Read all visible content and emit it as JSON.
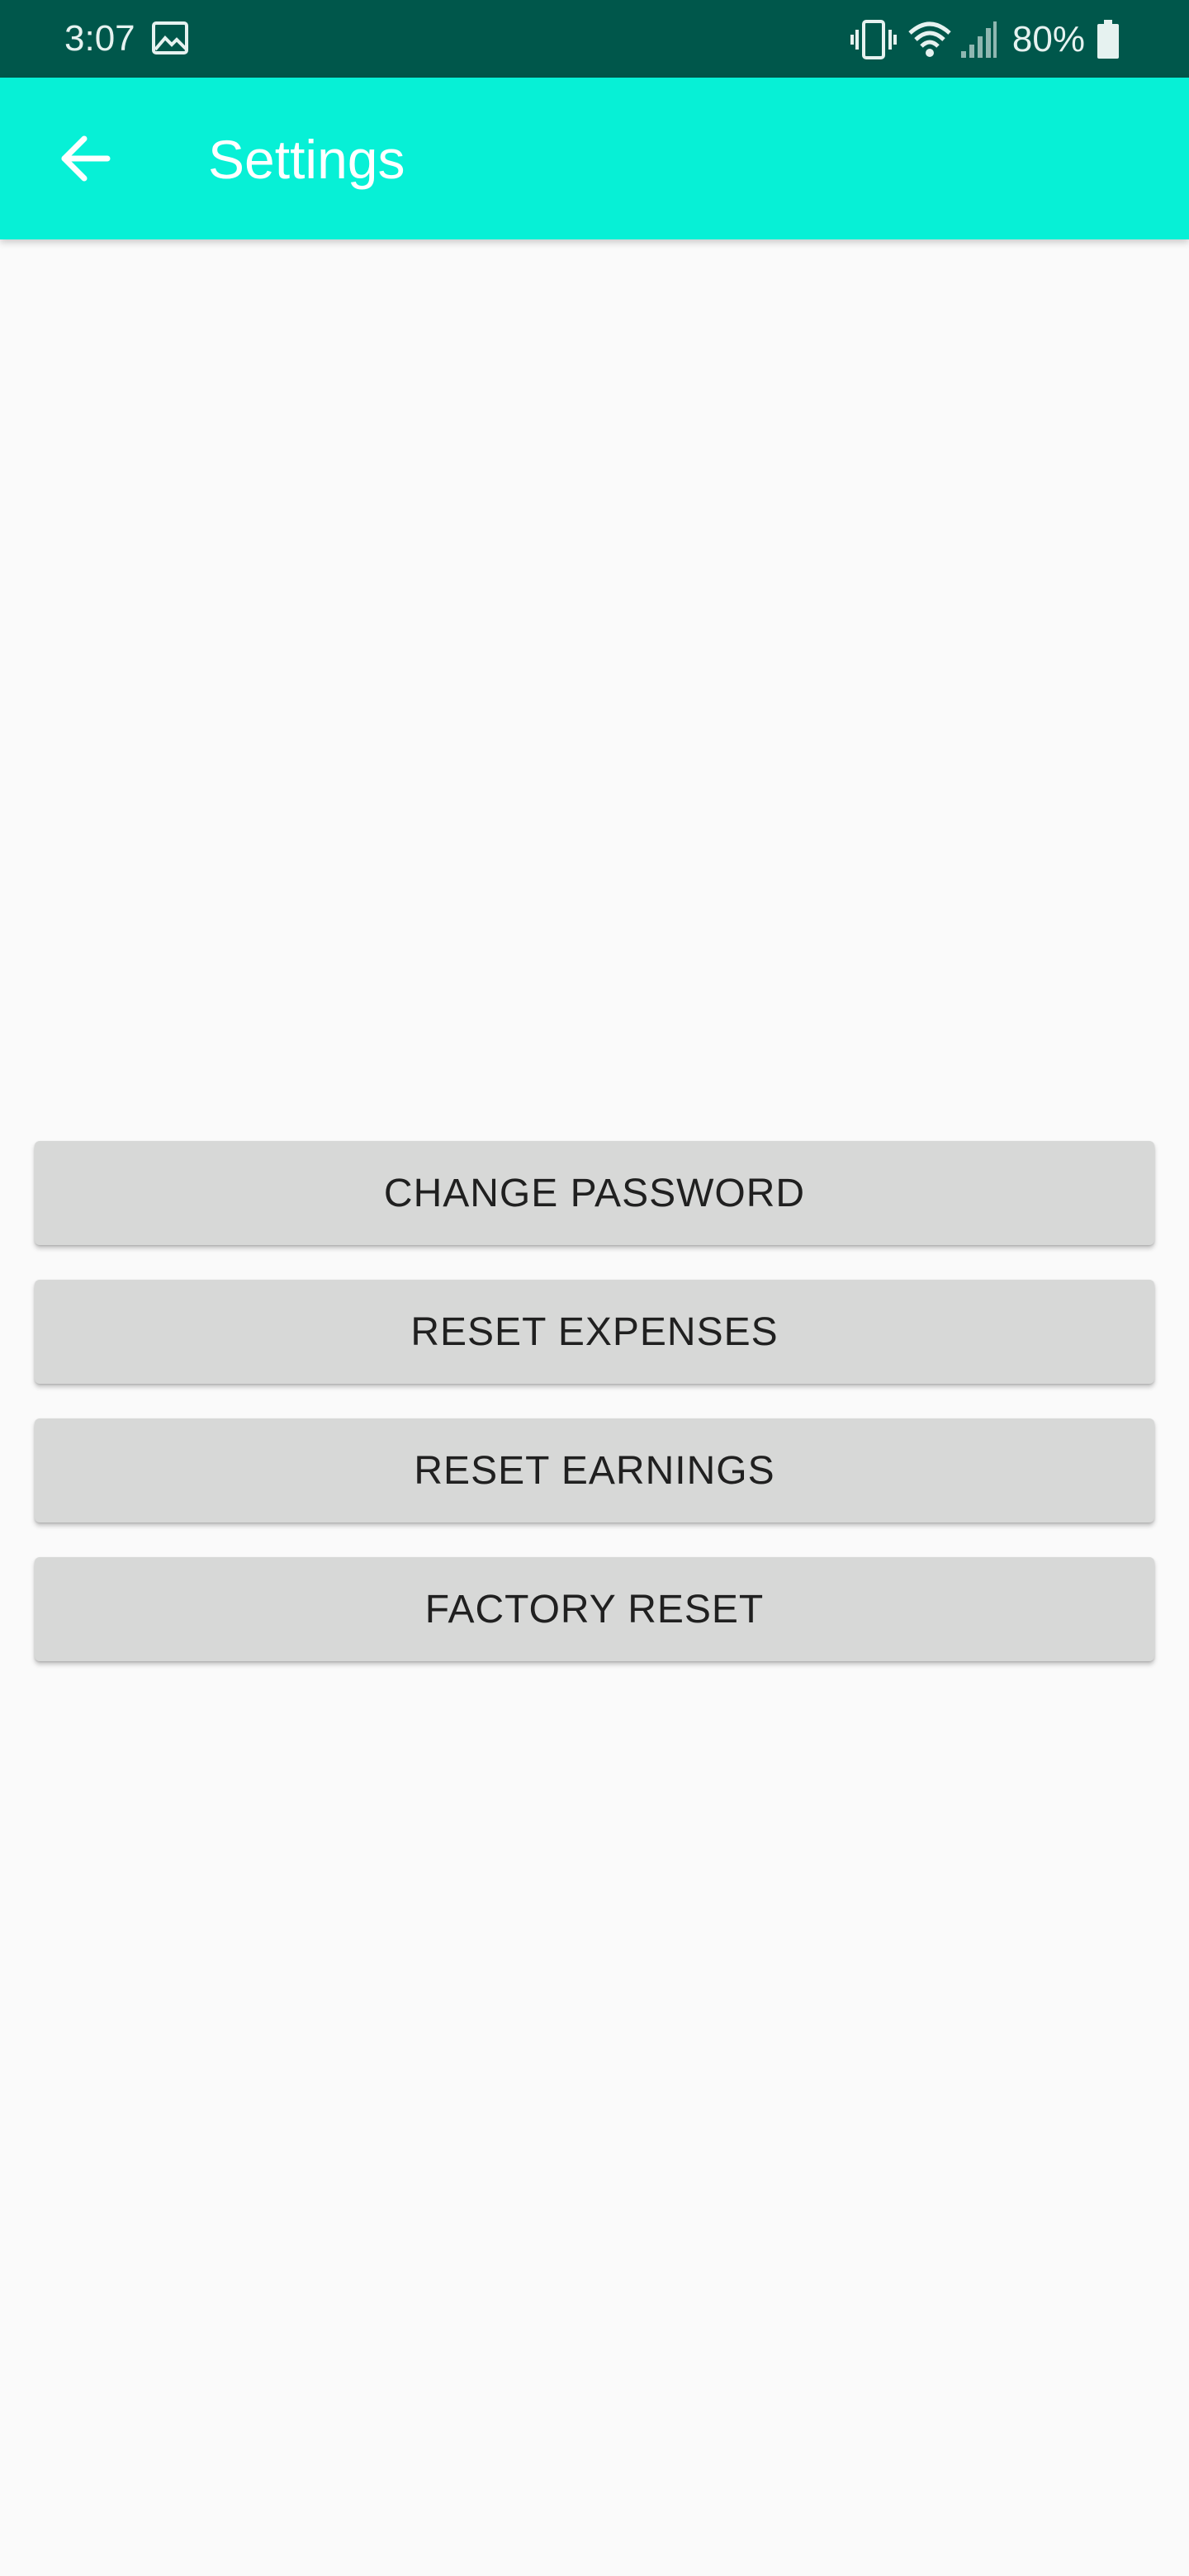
{
  "status_bar": {
    "time": "3:07",
    "battery_percent": "80%",
    "icons": [
      "image-icon",
      "vibrate-icon",
      "wifi-icon",
      "signal-icon",
      "battery-icon"
    ],
    "background_color": "#00574b"
  },
  "app_bar": {
    "title": "Settings",
    "back_icon": "arrow-back-icon",
    "background_color": "#07f0d6"
  },
  "actions": [
    {
      "label": "CHANGE PASSWORD"
    },
    {
      "label": "RESET EXPENSES"
    },
    {
      "label": "RESET EARNINGS"
    },
    {
      "label": "FACTORY RESET"
    }
  ],
  "colors": {
    "page_background": "#fafafa",
    "button_background": "#d7d8d7",
    "button_text": "#202020"
  }
}
